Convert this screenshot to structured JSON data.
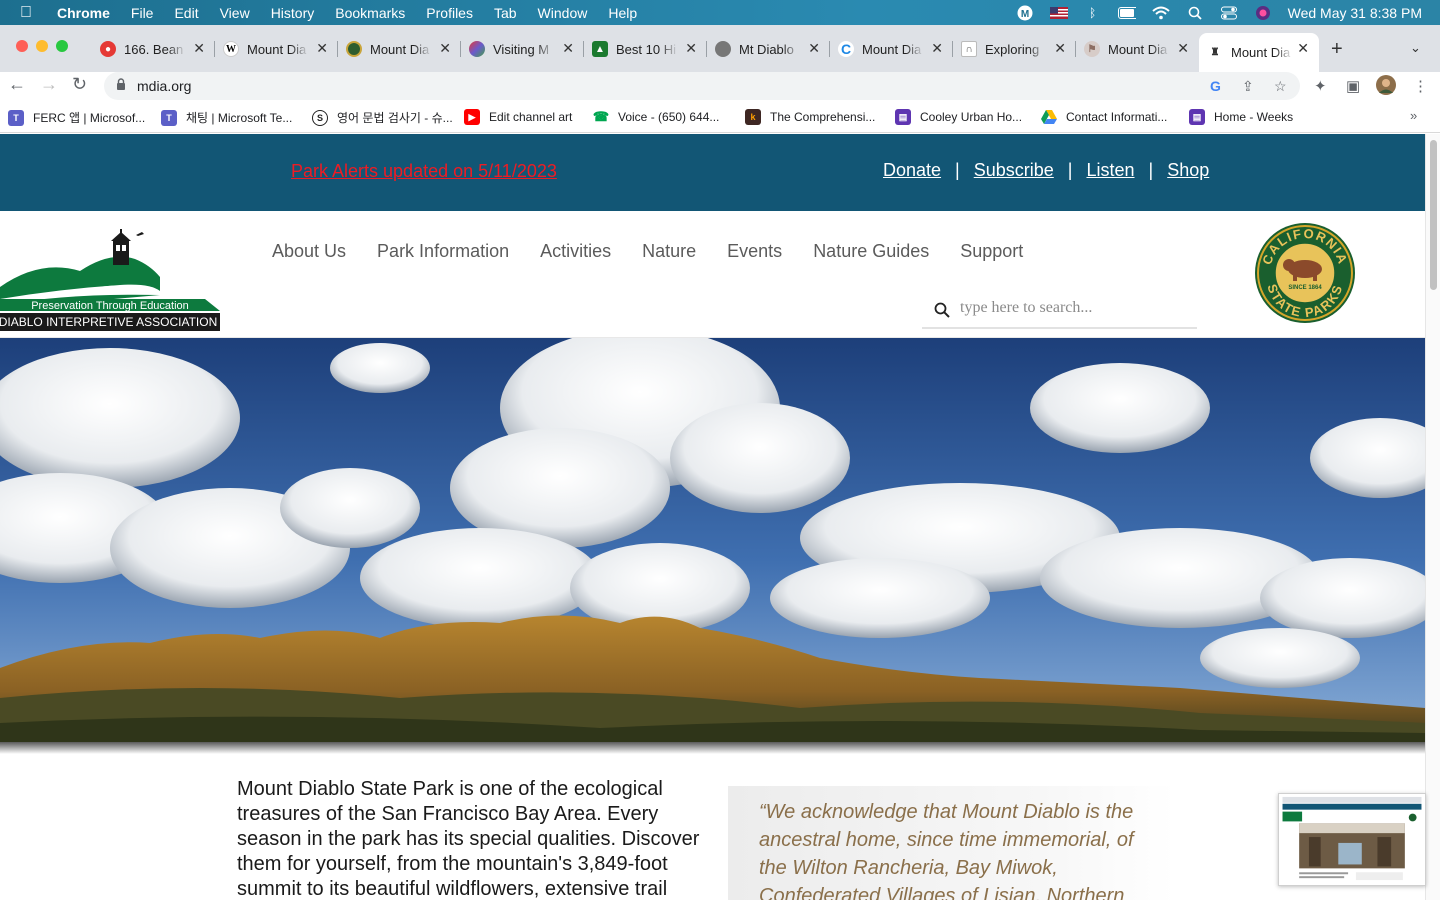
{
  "menubar": {
    "app": "Chrome",
    "items": [
      "File",
      "Edit",
      "View",
      "History",
      "Bookmarks",
      "Profiles",
      "Tab",
      "Window",
      "Help"
    ],
    "datetime": "Wed May 31  8:38 PM"
  },
  "tabs": [
    {
      "label": "166. Bean",
      "favicon": "red-circle-icon",
      "color": "#e53935"
    },
    {
      "label": "Mount Dia",
      "favicon": "wikipedia-icon",
      "color": "#ffffff"
    },
    {
      "label": "Mount Dia",
      "favicon": "park-seal-icon",
      "color": "#2e5d2e"
    },
    {
      "label": "Visiting M",
      "favicon": "mountain-icon",
      "color": "#6a5acd"
    },
    {
      "label": "Best 10 Hi",
      "favicon": "alltrails-icon",
      "color": "#1b7a2f"
    },
    {
      "label": "Mt Diablo",
      "favicon": "seal-icon",
      "color": "#555555"
    },
    {
      "label": "Mount Dia",
      "favicon": "c-logo-icon",
      "color": "#1e88e5"
    },
    {
      "label": "Exploring",
      "favicon": "landscape-icon",
      "color": "#888888"
    },
    {
      "label": "Mount Dia",
      "favicon": "hiker-icon",
      "color": "#8d6e63"
    },
    {
      "label": "Mount Dia",
      "favicon": "lighthouse-icon",
      "color": "#333333",
      "active": true
    }
  ],
  "address": {
    "url": "mdia.org"
  },
  "bookmarks": [
    {
      "label": "FERC 앱 | Microsof...",
      "color": "#5b5fc7",
      "glyph": "T"
    },
    {
      "label": "채팅 | Microsoft Te...",
      "color": "#5b5fc7",
      "glyph": "T"
    },
    {
      "label": "영어 문법 검사기 - 슈...",
      "color": "#222222",
      "glyph": "S"
    },
    {
      "label": "Edit channel art",
      "color": "#ff0000",
      "glyph": "▶"
    },
    {
      "label": "Voice - (650) 644...",
      "color": "#00a650",
      "glyph": "☎"
    },
    {
      "label": "The Comprehensi...",
      "color": "#8b4513",
      "glyph": "k"
    },
    {
      "label": "Cooley Urban Ho...",
      "color": "#5e35b1",
      "glyph": "▤"
    },
    {
      "label": "Contact Informati...",
      "color": "#fbbc04",
      "glyph": "▲"
    },
    {
      "label": "Home - Weeks",
      "color": "#5e35b1",
      "glyph": "▤"
    }
  ],
  "site": {
    "alert": "Park Alerts updated on 5/11/2023",
    "toplinks": [
      "Donate",
      "Subscribe",
      "Listen",
      "Shop"
    ],
    "nav": [
      "About Us",
      "Park Information",
      "Activities",
      "Nature",
      "Events",
      "Nature Guides",
      "Support"
    ],
    "search_placeholder": "type here to search...",
    "logo": {
      "tagline": "Preservation Through Education",
      "org": "DIABLO INTERPRETIVE ASSOCIATION"
    },
    "seal": {
      "top": "CALIFORNIA",
      "bottom": "STATE PARKS",
      "since": "SINCE 1864"
    },
    "intro": "Mount Diablo State Park is one of the ecological treasures of the San Francisco Bay Area. Every season in the park has its special qualities. Discover them for yourself, from the mountain's 3,849-foot summit to its beautiful wildflowers, extensive trail",
    "quote": "“We acknowledge that Mount Diablo is the ancestral home, since time immemorial, of the Wilton Rancheria, Bay Miwok, Confederated Villages of Lisjan, Northern"
  }
}
